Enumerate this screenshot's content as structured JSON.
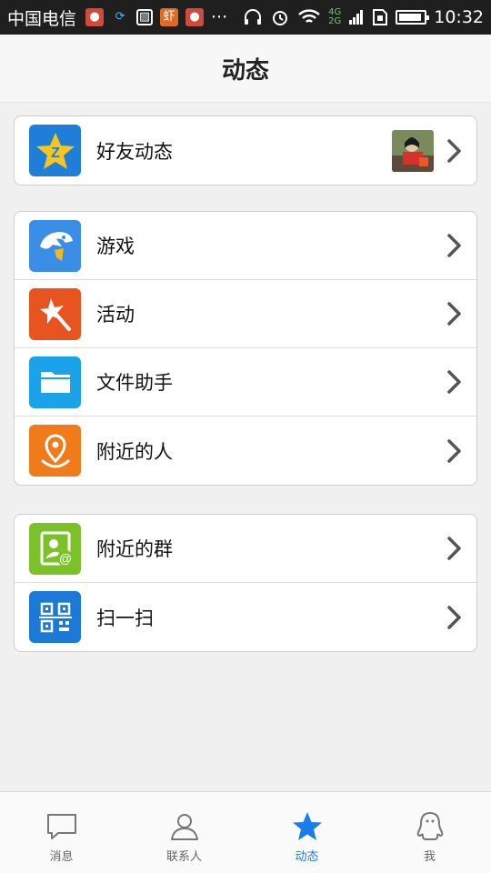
{
  "status_bar": {
    "carrier": "中国电信",
    "notif_icons": [
      "app-icon-1",
      "sync-icon",
      "image-icon",
      "shrimp-app-icon",
      "app-icon-2"
    ],
    "more": "···",
    "network_top": "4G",
    "network_bottom": "2G",
    "time": "10:32"
  },
  "header": {
    "title": "动态"
  },
  "groups": [
    {
      "items": [
        {
          "label": "好友动态",
          "icon": "qzone-star-icon",
          "color": "#1f7fd8"
        }
      ]
    },
    {
      "items": [
        {
          "label": "游戏",
          "icon": "game-shark-icon",
          "color": "#3a8ee6"
        },
        {
          "label": "活动",
          "icon": "activity-star-icon",
          "color": "#e8541f"
        },
        {
          "label": "文件助手",
          "icon": "folder-icon",
          "color": "#1aa3e8"
        },
        {
          "label": "附近的人",
          "icon": "location-pin-icon",
          "color": "#f07b1a"
        }
      ]
    },
    {
      "items": [
        {
          "label": "附近的群",
          "icon": "group-at-icon",
          "color": "#7bc22a"
        },
        {
          "label": "扫一扫",
          "icon": "qr-scan-icon",
          "color": "#1c7ad6"
        }
      ]
    }
  ],
  "tabs": [
    {
      "label": "消息",
      "icon": "message-icon",
      "active": false
    },
    {
      "label": "联系人",
      "icon": "contacts-icon",
      "active": false
    },
    {
      "label": "动态",
      "icon": "star-icon",
      "active": true
    },
    {
      "label": "我",
      "icon": "qq-penguin-icon",
      "active": false
    }
  ],
  "colors": {
    "accent": "#1a7de8",
    "status_bar": "#1f1f1f"
  }
}
